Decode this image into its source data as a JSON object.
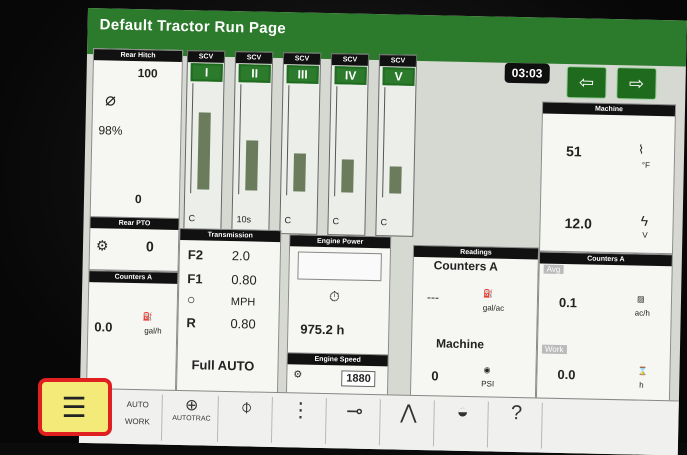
{
  "title": "Default Tractor Run Page",
  "clock": "03:03",
  "nav": {
    "back_icon": "arrow-left-icon",
    "forward_icon": "arrow-right-icon"
  },
  "rear_hitch": {
    "header": "Rear Hitch",
    "top": "100",
    "percent": "98%",
    "bottom": "0"
  },
  "scv": [
    {
      "header": "SCV",
      "roman": "I",
      "mode": "C",
      "level": 0.7
    },
    {
      "header": "SCV",
      "roman": "II",
      "mode": "10s",
      "level": 0.45
    },
    {
      "header": "SCV",
      "roman": "III",
      "mode": "C",
      "level": 0.35
    },
    {
      "header": "SCV",
      "roman": "IV",
      "mode": "C",
      "level": 0.3
    },
    {
      "header": "SCV",
      "roman": "V",
      "mode": "C",
      "level": 0.25
    }
  ],
  "machine": {
    "header": "Machine",
    "temp": "51",
    "temp_unit": "°F",
    "volt": "12.0",
    "volt_unit": "V"
  },
  "rear_pto": {
    "header": "Rear PTO",
    "value": "0"
  },
  "transmission": {
    "header": "Transmission",
    "rows": [
      {
        "gear": "F2",
        "value": "2.0"
      },
      {
        "gear": "F1",
        "value": "0.80"
      },
      {
        "gear": "",
        "value": "MPH"
      },
      {
        "gear": "R",
        "value": "0.80"
      }
    ],
    "mode": "Full AUTO"
  },
  "engine_power": {
    "header": "Engine Power",
    "hours": "975.2 h"
  },
  "engine_speed": {
    "header": "Engine Speed",
    "value": "1880"
  },
  "readings": {
    "header": "Readings",
    "counters": "Counters A",
    "dashes": "---",
    "unit": "gal/ac",
    "machine": "Machine",
    "psi_value": "0",
    "psi_unit": "PSI"
  },
  "counters_left": {
    "header": "Counters A",
    "value": "0.0",
    "unit": "gal/h"
  },
  "counters_right": {
    "header": "Counters A",
    "avg_label": "Avg",
    "avg_value": "0.1",
    "avg_unit": "ac/h",
    "work_label": "Work",
    "work_value": "0.0",
    "work_unit": "h"
  },
  "bottom": {
    "auto_label": "AUTO",
    "work_label": "WORK",
    "autotrac_label": "AUTOTRAC"
  }
}
